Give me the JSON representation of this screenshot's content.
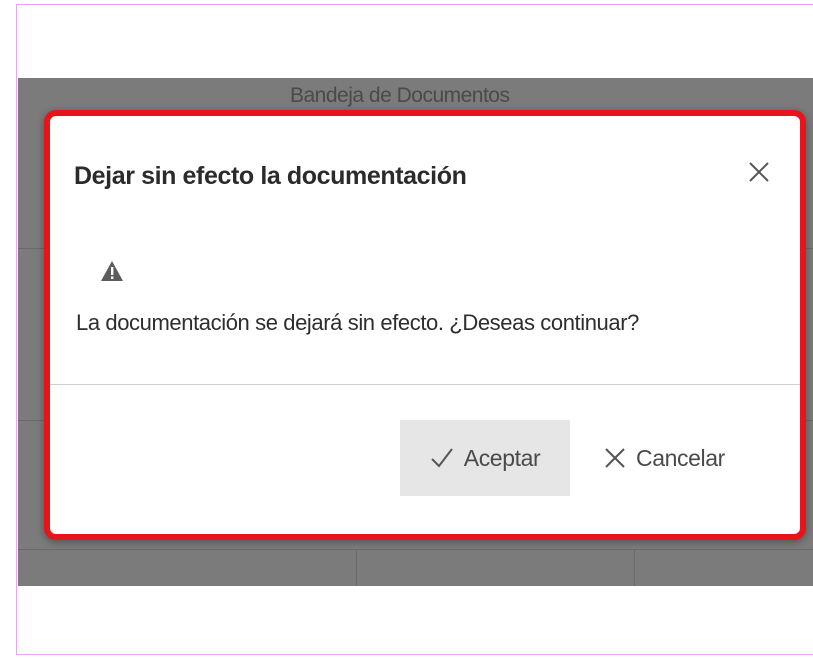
{
  "background": {
    "title": "Bandeja de Documentos"
  },
  "dialog": {
    "title": "Dejar sin efecto la documentación",
    "close_icon": "close-icon",
    "warning_icon": "warning-triangle-icon",
    "message": "La documentación se dejará sin efecto. ¿Deseas continuar?",
    "accept_label": "Aceptar",
    "accept_icon": "check-icon",
    "cancel_label": "Cancelar",
    "cancel_icon": "close-icon"
  },
  "colors": {
    "highlight_border": "#e8141b",
    "overlay": "#7b7b7b",
    "accept_button_bg": "#e6e6e6"
  }
}
